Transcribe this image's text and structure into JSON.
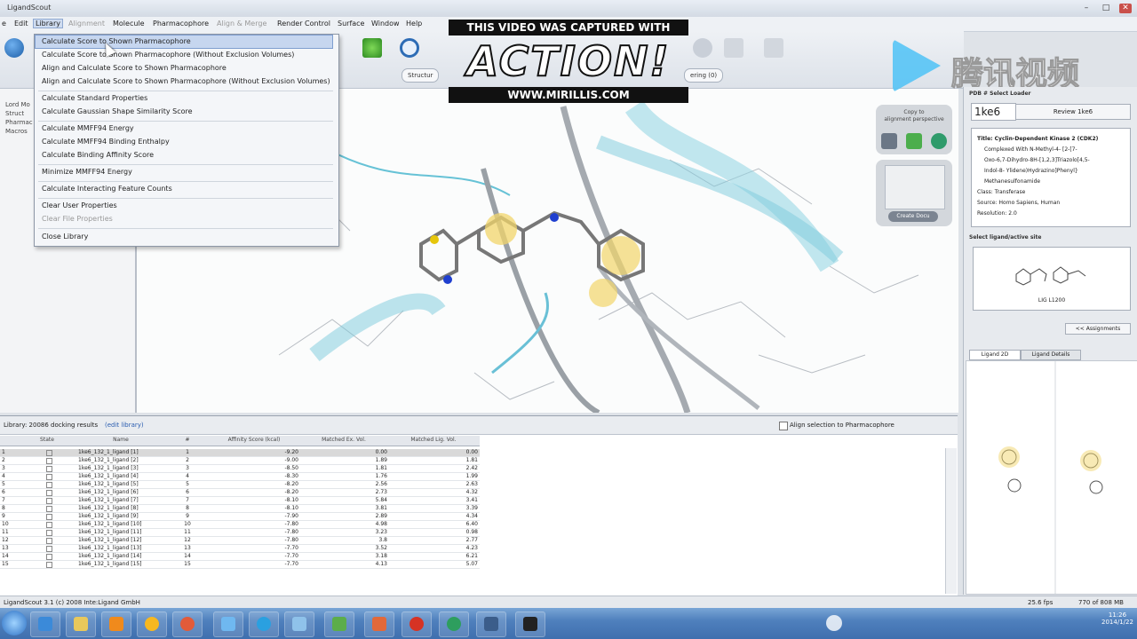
{
  "window": {
    "title": "LigandScout"
  },
  "menubar": [
    "e",
    "Edit",
    "Library",
    "Alignment",
    "Molecule",
    "Pharmacophore",
    "Align & Merge",
    "Render Control",
    "Surface",
    "Window",
    "Help"
  ],
  "dropdown": {
    "items": [
      {
        "label": "Calculate Score to Shown Pharmacophore",
        "state": "selected"
      },
      {
        "label": "Calculate Score to Shown Pharmacophore (Without Exclusion Volumes)",
        "state": ""
      },
      {
        "label": "Align and Calculate Score to Shown Pharmacophore",
        "state": ""
      },
      {
        "label": "Align and Calculate Score to Shown Pharmacophore (Without Exclusion Volumes)",
        "state": ""
      },
      {
        "label": "Calculate Standard Properties",
        "state": ""
      },
      {
        "label": "Calculate Gaussian Shape Similarity Score",
        "state": ""
      },
      {
        "label": "Calculate MMFF94 Energy",
        "state": ""
      },
      {
        "label": "Calculate MMFF94 Binding Enthalpy",
        "state": ""
      },
      {
        "label": "Calculate Binding Affinity Score",
        "state": ""
      },
      {
        "label": "Minimize MMFF94 Energy",
        "state": ""
      },
      {
        "label": "Calculate Interacting Feature Counts",
        "state": ""
      },
      {
        "label": "Clear User Properties",
        "state": ""
      },
      {
        "label": "Clear File Properties",
        "state": "disabled"
      },
      {
        "label": "Close Library",
        "state": ""
      }
    ]
  },
  "overlay": {
    "line1": "THIS VIDEO WAS CAPTURED WITH",
    "brand": "ACTION!",
    "url": "WWW.MIRILLIS.COM"
  },
  "watermark": {
    "text": "腾讯视频"
  },
  "toolbar": {
    "pill_left": "Structur",
    "pill_right": "ering (0)"
  },
  "left_panel": {
    "items": [
      "Lord Mo",
      "Struct",
      "Pharmac",
      "Macros"
    ]
  },
  "viewport_panels": {
    "p1_line1": "Copy to",
    "p1_line2": "alignment perspective",
    "p2_button": "Create Docu"
  },
  "right_panel": {
    "pdb_label": "PDB # Select Loader",
    "pdb_id": "1ke6",
    "review_button": "Review 1ke6",
    "info": [
      "Title: Cyclin-Dependent Kinase 2 (CDK2)",
      "Complexed With N-Methyl-4- [2-[7-",
      "Oxo-6,7-Dihydro-8H-[1,2,3]Triazolo[4,5-",
      "Indol-8- Ylidene)Hydrazino]Phenyl}",
      "Methanesulfonamide",
      "Class: Transferase",
      "Source: Homo Sapiens, Human",
      "Resolution: 2.0"
    ],
    "ligand_label": "Select ligand/active site",
    "ligand_caption": "LIG L1200",
    "assignments_button": "<< Assignments",
    "tabs": [
      "Ligand 2D",
      "Ligand Details"
    ]
  },
  "table": {
    "header_text": "Library: 20086 docking results",
    "header_link": "(edit library)",
    "align_label": "Align selection to Pharmacophore",
    "columns": [
      "State",
      "Name",
      "#",
      "Affinity Score (kcal)",
      "Matched Ex. Vol.",
      "Matched Lig. Vol."
    ],
    "rows": [
      [
        "1",
        "1ke6_132_1_ligand [1]",
        "1",
        "-9.20",
        "0.00",
        "0.00"
      ],
      [
        "2",
        "1ke6_132_1_ligand [2]",
        "2",
        "-9.00",
        "1.89",
        "1.81"
      ],
      [
        "3",
        "1ke6_132_1_ligand [3]",
        "3",
        "-8.50",
        "1.81",
        "2.42"
      ],
      [
        "4",
        "1ke6_132_1_ligand [4]",
        "4",
        "-8.30",
        "1.76",
        "1.99"
      ],
      [
        "5",
        "1ke6_132_1_ligand [5]",
        "5",
        "-8.20",
        "2.56",
        "2.63"
      ],
      [
        "6",
        "1ke6_132_1_ligand [6]",
        "6",
        "-8.20",
        "2.73",
        "4.32"
      ],
      [
        "7",
        "1ke6_132_1_ligand [7]",
        "7",
        "-8.10",
        "5.84",
        "3.41"
      ],
      [
        "8",
        "1ke6_132_1_ligand [8]",
        "8",
        "-8.10",
        "3.81",
        "3.39"
      ],
      [
        "9",
        "1ke6_132_1_ligand [9]",
        "9",
        "-7.90",
        "2.89",
        "4.34"
      ],
      [
        "10",
        "1ke6_132_1_ligand [10]",
        "10",
        "-7.80",
        "4.98",
        "6.40"
      ],
      [
        "11",
        "1ke6_132_1_ligand [11]",
        "11",
        "-7.80",
        "3.23",
        "0.98"
      ],
      [
        "12",
        "1ke6_132_1_ligand [12]",
        "12",
        "-7.80",
        "3.8",
        "2.77"
      ],
      [
        "13",
        "1ke6_132_1_ligand [13]",
        "13",
        "-7.70",
        "3.52",
        "4.23"
      ],
      [
        "14",
        "1ke6_132_1_ligand [14]",
        "14",
        "-7.70",
        "3.18",
        "6.21"
      ],
      [
        "15",
        "1ke6_132_1_ligand [15]",
        "15",
        "-7.70",
        "4.13",
        "5.07"
      ]
    ]
  },
  "statusbar": {
    "left": "LigandScout 3.1 (c) 2008 Inte:Ligand GmbH",
    "mid": "25.6 fps",
    "right": "770 of 808 MB"
  },
  "taskbar": {
    "clock_time": "11:26",
    "clock_date": "2014/1/22"
  }
}
